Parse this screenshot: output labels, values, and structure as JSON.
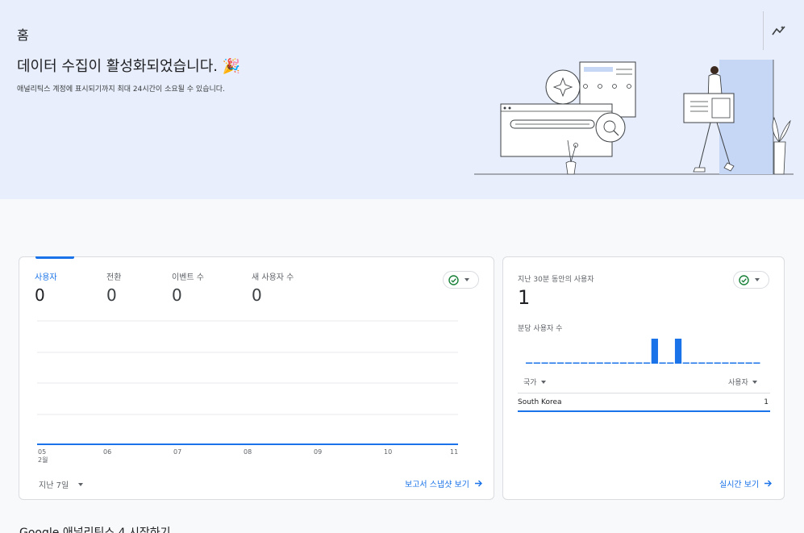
{
  "header": {
    "page_title": "홈",
    "insights_icon": "insights-icon"
  },
  "banner": {
    "title": "데이터 수집이 활성화되었습니다. 🎉",
    "subtitle": "애널리틱스 계정에 표시되기까지 최대 24시간이 소요될 수 있습니다."
  },
  "overview_card": {
    "metrics": [
      {
        "label": "사용자",
        "value": "0"
      },
      {
        "label": "전환",
        "value": "0"
      },
      {
        "label": "이벤트 수",
        "value": "0"
      },
      {
        "label": "새 사용자 수",
        "value": "0"
      }
    ],
    "status_icon": "check-circle-icon",
    "x_ticks": [
      "05",
      "06",
      "07",
      "08",
      "09",
      "10",
      "11"
    ],
    "x_month": "2월",
    "date_range": "지난 7일",
    "link_label": "보고서 스냅샷 보기"
  },
  "realtime_card": {
    "title": "지난 30분 동안의 사용자",
    "value": "1",
    "subtitle": "분당 사용자 수",
    "bars_per_minute": [
      0,
      0,
      0,
      0,
      0,
      0,
      0,
      0,
      0,
      0,
      0,
      0,
      0,
      0,
      0,
      0,
      1,
      0,
      0,
      1,
      0,
      0,
      0,
      0,
      0,
      0,
      0,
      0,
      0,
      0
    ],
    "table": {
      "col_country": "국가",
      "col_users": "사용자",
      "rows": [
        {
          "country": "South Korea",
          "users": "1"
        }
      ]
    },
    "link_label": "실시간 보기"
  },
  "next_section": {
    "title": "Google 애널리틱스 4 시작하기"
  },
  "colors": {
    "accent": "#1a73e8",
    "banner_bg": "#e8eefb",
    "success": "#188038"
  }
}
